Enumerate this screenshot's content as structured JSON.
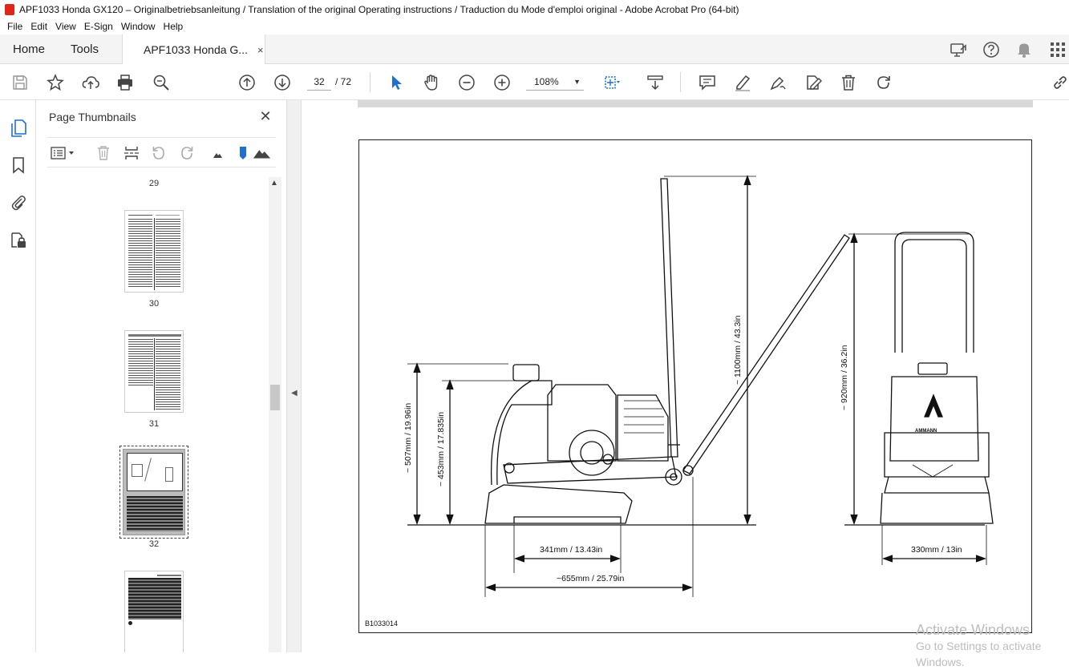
{
  "window": {
    "title": "APF1033 Honda GX120 – Originalbetriebsanleitung / Translation of the original Operating instructions / Traduction du Mode d'emploi original - Adobe Acrobat Pro (64-bit)"
  },
  "menu": [
    "File",
    "Edit",
    "View",
    "E-Sign",
    "Window",
    "Help"
  ],
  "tabs": {
    "home": "Home",
    "tools": "Tools",
    "document": "APF1033 Honda G...",
    "close": "×"
  },
  "toolbar": {
    "current_page": "32",
    "total_pages": "/ 72",
    "zoom": "108%"
  },
  "thumbnails": {
    "title": "Page Thumbnails",
    "close": "✕",
    "pages": [
      {
        "number": "29"
      },
      {
        "number": "30"
      },
      {
        "number": "31"
      },
      {
        "number": "32"
      },
      {
        "number": ""
      }
    ]
  },
  "figure": {
    "id": "B1033014",
    "dims": {
      "height_total": "~ 507mm / 19.96in",
      "height_engine": "~ 453mm / 17.835in",
      "handle_height_max": "~ 1100mm / 43.3in",
      "handle_height_front": "~ 920mm / 36.2in",
      "plate_length": "341mm / 13.43in",
      "overall_length": "~655mm / 25.79in",
      "plate_width": "330mm / 13in"
    },
    "brand": "AMMANN"
  },
  "watermark": {
    "line1": "Activate Windows",
    "line2": "Go to Settings to activate Windows."
  },
  "colors": {
    "accent": "#1f6fd1",
    "acrobat_red": "#e0261b"
  }
}
